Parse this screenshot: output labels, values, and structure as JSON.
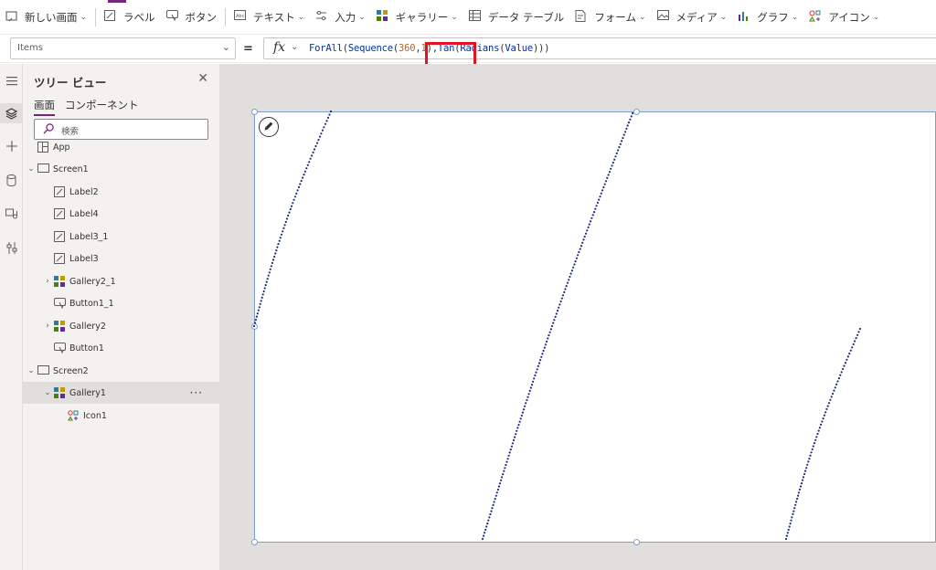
{
  "ribbon": {
    "items": [
      {
        "label": "新しい画面",
        "icon": "new-screen-icon",
        "chevron": true
      },
      {
        "label": "ラベル",
        "icon": "label-icon",
        "chevron": false
      },
      {
        "label": "ボタン",
        "icon": "button-icon",
        "chevron": false
      },
      {
        "label": "テキスト",
        "icon": "text-input-icon",
        "chevron": true
      },
      {
        "label": "入力",
        "icon": "input-icon",
        "chevron": true
      },
      {
        "label": "ギャラリー",
        "icon": "gallery-icon",
        "chevron": true
      },
      {
        "label": "データ テーブル",
        "icon": "data-table-icon",
        "chevron": false
      },
      {
        "label": "フォーム",
        "icon": "form-icon",
        "chevron": true
      },
      {
        "label": "メディア",
        "icon": "media-icon",
        "chevron": true
      },
      {
        "label": "グラフ",
        "icon": "chart-icon",
        "chevron": true
      },
      {
        "label": "アイコン",
        "icon": "icons-icon",
        "chevron": true
      }
    ],
    "accent_color": "#742774"
  },
  "formula_bar": {
    "property": "Items",
    "equals": "=",
    "fx_label": "fx",
    "formula_parts": {
      "p1": "ForAll",
      "p2": "(",
      "p3": "Sequence",
      "p4": "(",
      "p5": "360",
      "p6": ",",
      "p7": "1",
      "p8": "),",
      "p9": "Tan",
      "p10": "(",
      "p11": "Radians",
      "p12": "(",
      "p13": "Value",
      "p14": ")))"
    },
    "highlight_color": "#e81123"
  },
  "rail": {
    "icons": [
      "hamburger-icon",
      "layers-icon",
      "plus-icon",
      "database-icon",
      "media-icon",
      "tools-icon"
    ]
  },
  "tree_view": {
    "title": "ツリー ビュー",
    "tabs": [
      "画面",
      "コンポーネント"
    ],
    "search_placeholder": "検索",
    "nodes": [
      {
        "label": "App",
        "icon": "app-icon",
        "expander": ""
      },
      {
        "label": "Screen1",
        "icon": "screen-icon",
        "expander": "⌄"
      },
      {
        "label": "Label2",
        "icon": "label-icon",
        "expander": ""
      },
      {
        "label": "Label4",
        "icon": "label-icon",
        "expander": ""
      },
      {
        "label": "Label3_1",
        "icon": "label-icon",
        "expander": ""
      },
      {
        "label": "Label3",
        "icon": "label-icon",
        "expander": ""
      },
      {
        "label": "Gallery2_1",
        "icon": "gallery-icon",
        "expander": "›"
      },
      {
        "label": "Button1_1",
        "icon": "button-icon",
        "expander": ""
      },
      {
        "label": "Gallery2",
        "icon": "gallery-icon",
        "expander": "›"
      },
      {
        "label": "Button1",
        "icon": "button-icon",
        "expander": ""
      },
      {
        "label": "Screen2",
        "icon": "screen-icon",
        "expander": "⌄"
      },
      {
        "label": "Gallery1",
        "icon": "gallery-icon",
        "expander": "⌄",
        "selected": true
      },
      {
        "label": "Icon1",
        "icon": "icon-control-icon",
        "expander": ""
      }
    ],
    "more_label": "···"
  },
  "canvas": {
    "dot_color": "#1f2a80",
    "edit_icon": "pencil-icon"
  }
}
